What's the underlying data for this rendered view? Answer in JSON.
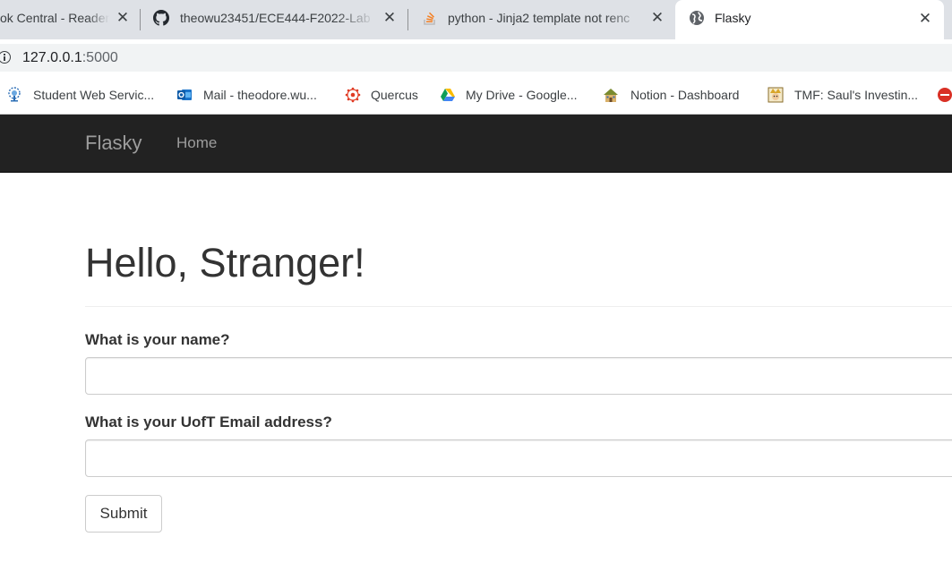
{
  "browser": {
    "tabs": [
      {
        "title": "ok Central - Reader",
        "icon": "reader-icon",
        "active": false
      },
      {
        "title": "theowu23451/ECE444-F2022-Lab",
        "icon": "github-icon",
        "active": false
      },
      {
        "title": "python - Jinja2 template not renc",
        "icon": "stackoverflow-icon",
        "active": false
      },
      {
        "title": "Flasky",
        "icon": "globe-icon",
        "active": true
      }
    ],
    "close_glyph": "✕",
    "address": {
      "host": "127.0.0.1",
      "port": ":5000"
    },
    "bookmarks": [
      {
        "label": "Student Web Servic...",
        "icon": "tree-icon"
      },
      {
        "label": "Mail - theodore.wu...",
        "icon": "outlook-icon"
      },
      {
        "label": "Quercus",
        "icon": "quercus-icon"
      },
      {
        "label": "My Drive - Google...",
        "icon": "google-drive-icon"
      },
      {
        "label": "Notion - Dashboard",
        "icon": "notion-house-icon"
      },
      {
        "label": "TMF: Saul's Investin...",
        "icon": "motley-fool-icon"
      }
    ]
  },
  "navbar": {
    "brand": "Flasky",
    "home": "Home"
  },
  "main": {
    "heading": "Hello, Stranger!",
    "form": {
      "name_label": "What is your name?",
      "name_value": "",
      "email_label": "What is your UofT Email address?",
      "email_value": "",
      "submit_label": "Submit"
    }
  },
  "colors": {
    "tabstrip": "#dee1e6",
    "navbar": "#222222",
    "navbar_text": "#9d9d9d",
    "heading_text": "#333333"
  }
}
